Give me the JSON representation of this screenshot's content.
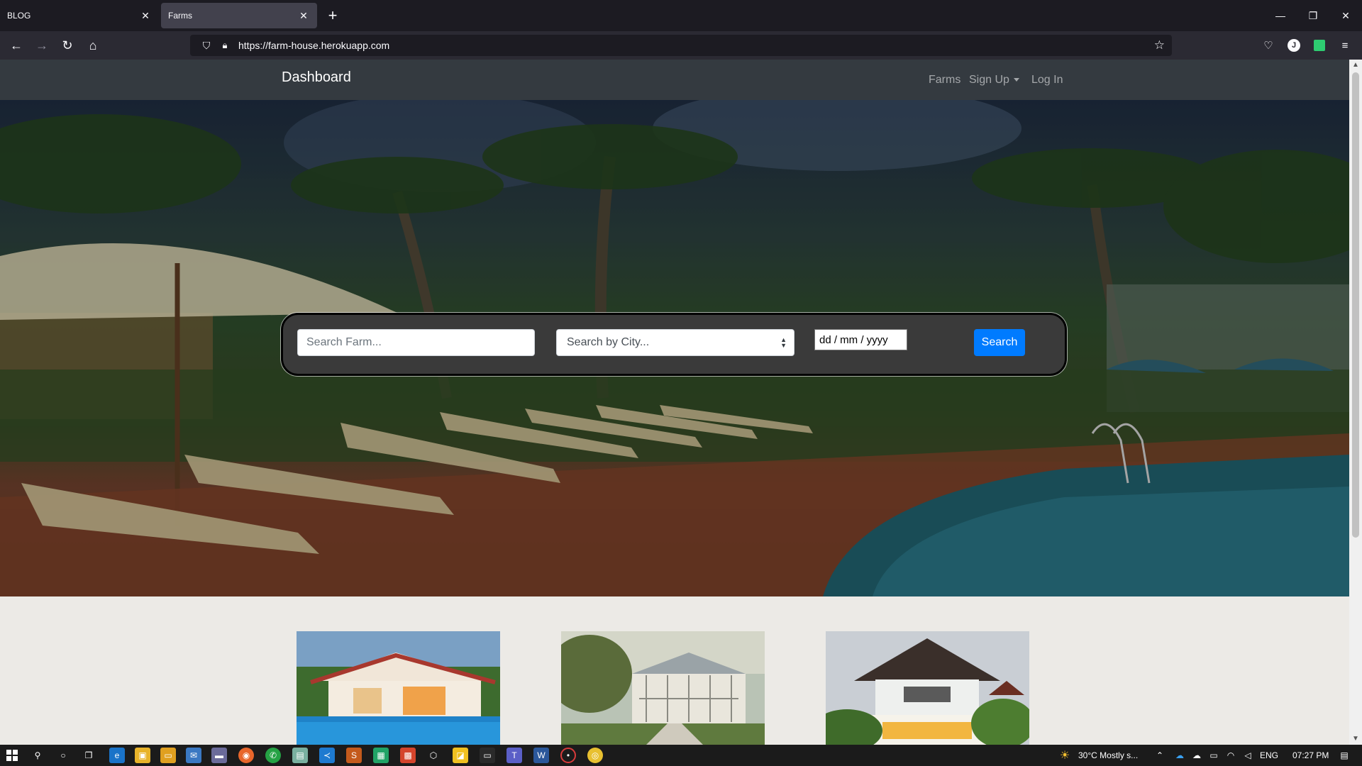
{
  "browser": {
    "tabs": [
      {
        "title": "BLOG",
        "active": false
      },
      {
        "title": "Farms",
        "active": true
      }
    ],
    "url": "https://farm-house.herokuapp.com"
  },
  "site": {
    "brand": "Dashboard",
    "nav": {
      "farms": "Farms",
      "signup": "Sign Up",
      "login": "Log In"
    },
    "search": {
      "farm_placeholder": "Search Farm...",
      "city_placeholder": "Search by City...",
      "date_placeholder": "dd / mm / yyyy",
      "button": "Search"
    },
    "colors": {
      "navbar": "#343a40",
      "primary": "#007bff"
    }
  },
  "taskbar": {
    "weather": "30°C  Mostly s...",
    "language": "ENG",
    "time": "07:27 PM"
  }
}
